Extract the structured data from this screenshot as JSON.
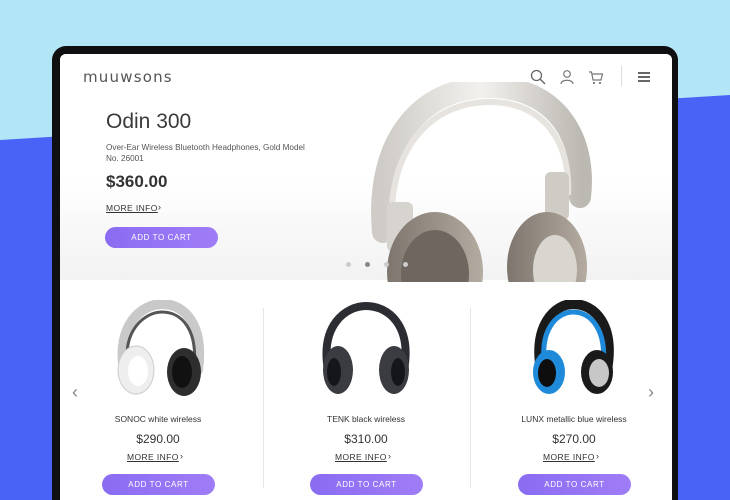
{
  "brand": {
    "logo": "muuwsons"
  },
  "header": {
    "icons": [
      "search-icon",
      "user-icon",
      "cart-icon",
      "menu-icon"
    ]
  },
  "hero": {
    "title": "Odin 300",
    "subtitle": "Over-Ear Wireless Bluetooth Headphones, Gold Model No. 26001",
    "price": "$360.00",
    "more_info": "MORE INFO",
    "cta": "ADD TO CART",
    "carousel": {
      "count": 4,
      "active_index": 1
    }
  },
  "products": [
    {
      "name": "SONOC white wireless",
      "price": "$290.00",
      "more_info": "MORE INFO",
      "cta": "ADD TO CART",
      "color": "#f2f2f2"
    },
    {
      "name": "TENK black wireless",
      "price": "$310.00",
      "more_info": "MORE INFO",
      "cta": "ADD TO CART",
      "color": "#2b2d33"
    },
    {
      "name": "LUNX metallic blue wireless",
      "price": "$270.00",
      "more_info": "MORE INFO",
      "cta": "ADD TO CART",
      "color": "#1f8ad9"
    }
  ],
  "colors": {
    "accent": "#9a78f6",
    "frame": "#0f0f12",
    "background_top": "#b2e5f6",
    "background_bottom": "#4a63f7"
  }
}
